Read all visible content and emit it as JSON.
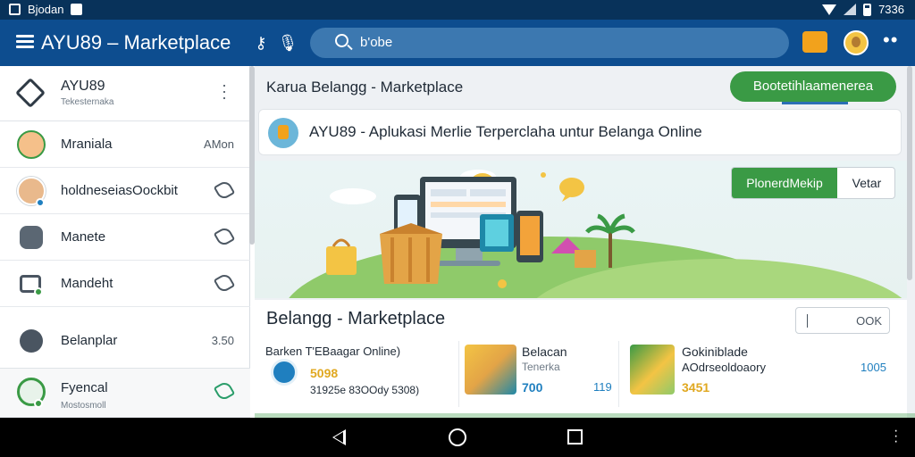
{
  "status_bar": {
    "left_text": "Bjodan",
    "time": "7336"
  },
  "app_bar": {
    "title": "AYU89 – Marketplace",
    "search_text": "b'obe",
    "more_glyph": "••"
  },
  "sidebar": {
    "header": {
      "name": "AYU89",
      "subtitle": "Tekesternaka"
    },
    "items": [
      {
        "label": "Mraniala",
        "meta": "AMon"
      },
      {
        "label": "holdneseiasOockbit",
        "meta": ""
      },
      {
        "label": "Manete",
        "meta": ""
      },
      {
        "label": "Mandeht",
        "meta": ""
      },
      {
        "label": "Belanplar",
        "meta": "3.50"
      },
      {
        "label": "Fyencal",
        "sublabel": "Mostosmoll",
        "meta": ""
      }
    ]
  },
  "main": {
    "page_title": "Karua Belangg - Marketplace",
    "primary_button": "Bootetihlaamenerea",
    "info_text": "AYU89 - Aplukasi Merlie Terperclaha untur Belanga Online",
    "toggle": {
      "on": "PlonerdMekip",
      "off": "Vetar"
    },
    "section_title": "Belangg - Marketplace",
    "section_input_value": "OOK",
    "products": [
      {
        "title": "Barken  T'EBaagar Online)",
        "price": "5098",
        "detail": "31925e  83OOdy 5308)"
      },
      {
        "title": "Belacan",
        "subtitle": "Tenerka",
        "price": "700",
        "count": "119"
      },
      {
        "title": "Gokiniblade",
        "subtitle": "AOdrseoldoaory",
        "price": "3451",
        "count": "1005"
      }
    ]
  },
  "colors": {
    "appbar": "#0d4d8f",
    "accent_green": "#3a9a45",
    "price_yellow": "#e0a820",
    "price_blue": "#1f7fbf"
  }
}
